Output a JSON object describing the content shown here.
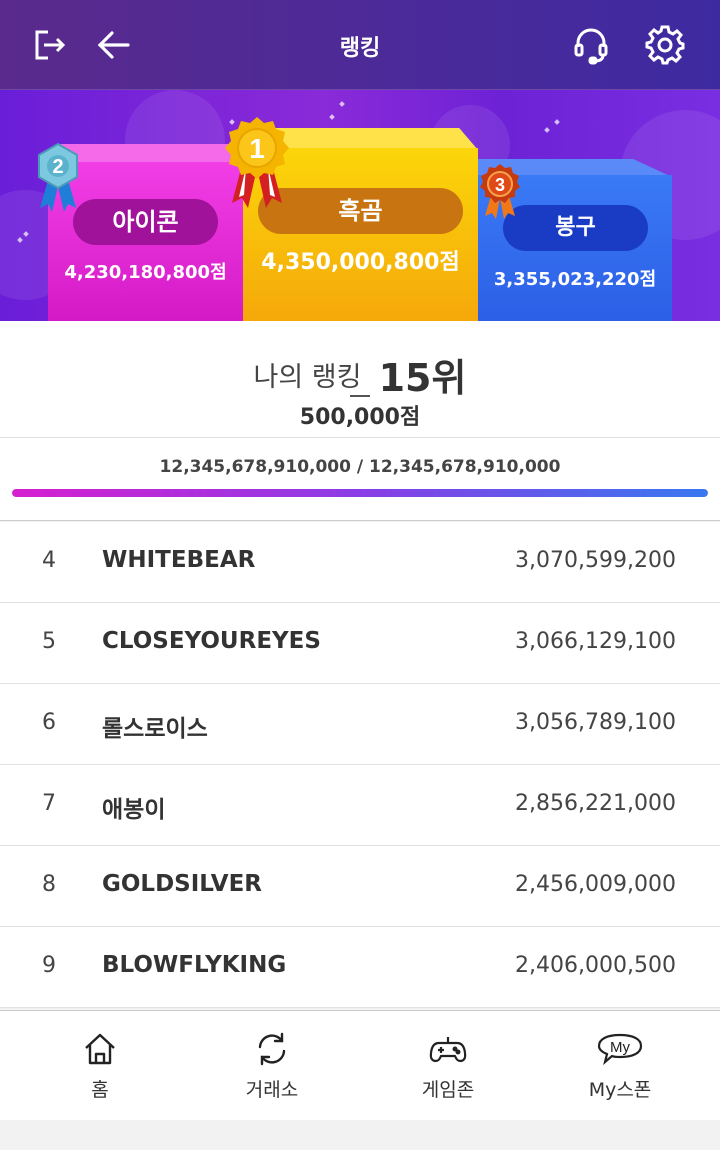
{
  "header": {
    "title": "랭킹"
  },
  "podium": {
    "first": {
      "rank_badge": "1",
      "name": "흑곰",
      "score": "4,350,000,800점"
    },
    "second": {
      "rank_badge": "2",
      "name": "아이콘",
      "score": "4,230,180,800점"
    },
    "third": {
      "rank_badge": "3",
      "name": "봉구",
      "score": "3,355,023,220점"
    }
  },
  "my_ranking": {
    "label": "나의 랭킹",
    "rank": "15위",
    "points": "500,000점",
    "progress_text": "12,345,678,910,000 / 12,345,678,910,000",
    "progress_fraction": 1.0
  },
  "ranking_list": [
    {
      "rank": "4",
      "name": "WHITEBEAR",
      "score": "3,070,599,200"
    },
    {
      "rank": "5",
      "name": "CLOSEYOUREYES",
      "score": "3,066,129,100"
    },
    {
      "rank": "6",
      "name": "롤스로이스",
      "score": "3,056,789,100"
    },
    {
      "rank": "7",
      "name": "애봉이",
      "score": "2,856,221,000"
    },
    {
      "rank": "8",
      "name": "GOLDSILVER",
      "score": "2,456,009,000"
    },
    {
      "rank": "9",
      "name": "BLOWFLYKING",
      "score": "2,406,000,500"
    }
  ],
  "bottom_nav": [
    {
      "label": "홈",
      "icon": "home-icon"
    },
    {
      "label": "거래소",
      "icon": "exchange-icon"
    },
    {
      "label": "게임존",
      "icon": "gamepad-icon"
    },
    {
      "label": "My스폰",
      "icon": "my-icon",
      "icon_text": "My"
    }
  ],
  "colors": {
    "header": "#4a2a9a",
    "gold": "#f5b800",
    "pink": "#e022c8",
    "blue": "#2f6cf0"
  }
}
